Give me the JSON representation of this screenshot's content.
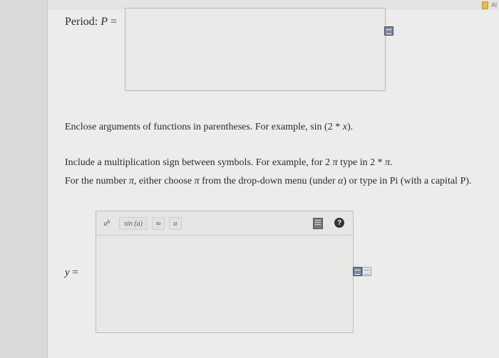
{
  "corner": {
    "text": "Al"
  },
  "question1": {
    "label": "Period:",
    "var": "P",
    "eq": "="
  },
  "instructions": {
    "line1": {
      "pre": "Enclose arguments of functions in parentheses. For example, sin (2 * ",
      "var": "x",
      "post": ")."
    },
    "line2": {
      "pre": "Include a multiplication sign between symbols. For example, for 2 ",
      "pi": "π",
      "mid": " type in  2 * ",
      "pi2": "π",
      "post": "."
    },
    "line3": {
      "pre": "For the number ",
      "pi": "π",
      "mid1": ", either choose ",
      "pi2": "π",
      "mid2": " from the drop-down menu (under ",
      "alpha": "α",
      "post": ") or type in Pi (with a capital P)."
    }
  },
  "toolbar": {
    "btn_power_base": "a",
    "btn_power_exp": "b",
    "btn_sin": "sin (a)",
    "btn_infinity": "∞",
    "btn_alpha": "α",
    "help": "?"
  },
  "question2": {
    "var": "y",
    "eq": "="
  },
  "icons": {
    "answer1_icon": "math-editor-icon",
    "answer2_icon": "math-editor-icon",
    "answer2_icon2": "preview-icon",
    "keyboard": "keyboard-icon",
    "help": "help-icon"
  }
}
